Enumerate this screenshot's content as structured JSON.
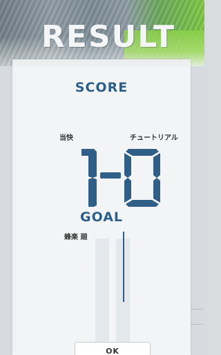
{
  "header": {
    "title": "RESULT"
  },
  "score": {
    "label": "SCORE",
    "home_team": "当快",
    "away_team": "チュートリアル",
    "home_goals": "1",
    "away_goals": "0"
  },
  "goals": {
    "label": "GOAL",
    "scorers": [
      "蜂楽 廻"
    ]
  },
  "actions": {
    "ok_label": "OK"
  },
  "colors": {
    "accent": "#2a5f8a",
    "digit": "#2f5f86",
    "card_bg": "#f3f4f5",
    "banner_green": "#7cc642"
  }
}
